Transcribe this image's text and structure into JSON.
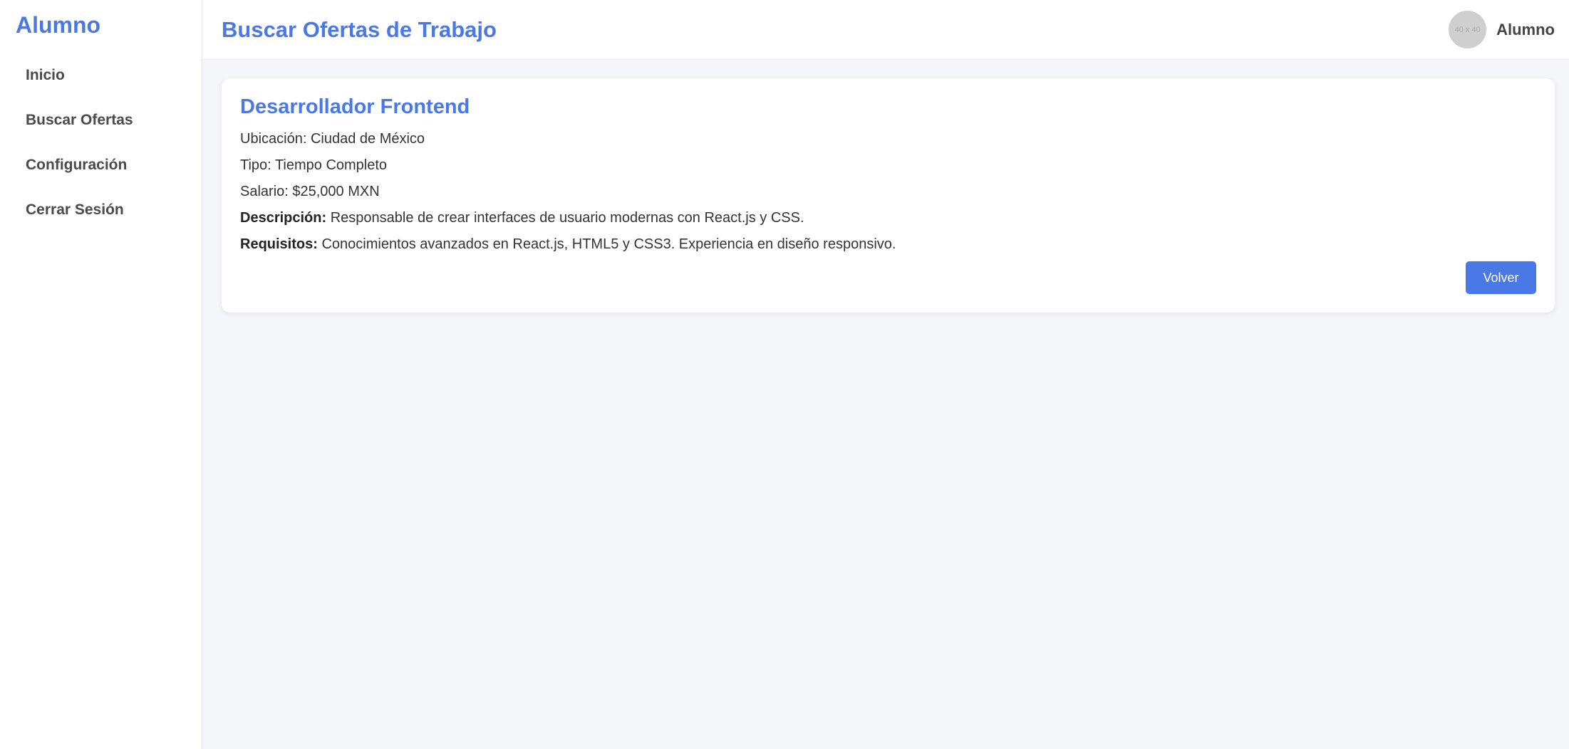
{
  "sidebar": {
    "brand": "Alumno",
    "items": [
      {
        "label": "Inicio"
      },
      {
        "label": "Buscar Ofertas"
      },
      {
        "label": "Configuración"
      },
      {
        "label": "Cerrar Sesión"
      }
    ]
  },
  "header": {
    "title": "Buscar Ofertas de Trabajo",
    "avatar_text": "40 x 40",
    "user_name": "Alumno"
  },
  "job": {
    "title": "Desarrollador Frontend",
    "location_label": "Ubicación:",
    "location": "Ciudad de México",
    "type_label": "Tipo:",
    "type": "Tiempo Completo",
    "salary_label": "Salario:",
    "salary": "$25,000 MXN",
    "description_label": "Descripción:",
    "description": "Responsable de crear interfaces de usuario modernas con React.js y CSS.",
    "requirements_label": "Requisitos:",
    "requirements": "Conocimientos avanzados en React.js, HTML5 y CSS3. Experiencia en diseño responsivo.",
    "back_label": "Volver"
  },
  "colors": {
    "accent": "#4a78e6",
    "background": "#f4f6fa"
  }
}
